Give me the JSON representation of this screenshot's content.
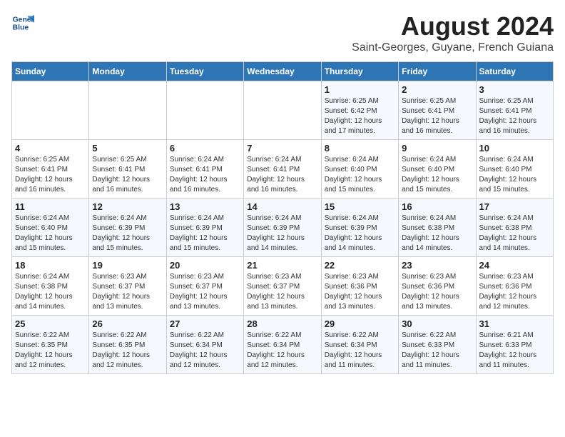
{
  "logo": {
    "line1": "General",
    "line2": "Blue"
  },
  "title": "August 2024",
  "subtitle": "Saint-Georges, Guyane, French Guiana",
  "header": {
    "colors": {
      "accent": "#2e75b6"
    }
  },
  "weekdays": [
    "Sunday",
    "Monday",
    "Tuesday",
    "Wednesday",
    "Thursday",
    "Friday",
    "Saturday"
  ],
  "weeks": [
    [
      {
        "day": "",
        "info": ""
      },
      {
        "day": "",
        "info": ""
      },
      {
        "day": "",
        "info": ""
      },
      {
        "day": "",
        "info": ""
      },
      {
        "day": "1",
        "info": "Sunrise: 6:25 AM\nSunset: 6:42 PM\nDaylight: 12 hours\nand 17 minutes."
      },
      {
        "day": "2",
        "info": "Sunrise: 6:25 AM\nSunset: 6:41 PM\nDaylight: 12 hours\nand 16 minutes."
      },
      {
        "day": "3",
        "info": "Sunrise: 6:25 AM\nSunset: 6:41 PM\nDaylight: 12 hours\nand 16 minutes."
      }
    ],
    [
      {
        "day": "4",
        "info": "Sunrise: 6:25 AM\nSunset: 6:41 PM\nDaylight: 12 hours\nand 16 minutes."
      },
      {
        "day": "5",
        "info": "Sunrise: 6:25 AM\nSunset: 6:41 PM\nDaylight: 12 hours\nand 16 minutes."
      },
      {
        "day": "6",
        "info": "Sunrise: 6:24 AM\nSunset: 6:41 PM\nDaylight: 12 hours\nand 16 minutes."
      },
      {
        "day": "7",
        "info": "Sunrise: 6:24 AM\nSunset: 6:41 PM\nDaylight: 12 hours\nand 16 minutes."
      },
      {
        "day": "8",
        "info": "Sunrise: 6:24 AM\nSunset: 6:40 PM\nDaylight: 12 hours\nand 15 minutes."
      },
      {
        "day": "9",
        "info": "Sunrise: 6:24 AM\nSunset: 6:40 PM\nDaylight: 12 hours\nand 15 minutes."
      },
      {
        "day": "10",
        "info": "Sunrise: 6:24 AM\nSunset: 6:40 PM\nDaylight: 12 hours\nand 15 minutes."
      }
    ],
    [
      {
        "day": "11",
        "info": "Sunrise: 6:24 AM\nSunset: 6:40 PM\nDaylight: 12 hours\nand 15 minutes."
      },
      {
        "day": "12",
        "info": "Sunrise: 6:24 AM\nSunset: 6:39 PM\nDaylight: 12 hours\nand 15 minutes."
      },
      {
        "day": "13",
        "info": "Sunrise: 6:24 AM\nSunset: 6:39 PM\nDaylight: 12 hours\nand 15 minutes."
      },
      {
        "day": "14",
        "info": "Sunrise: 6:24 AM\nSunset: 6:39 PM\nDaylight: 12 hours\nand 14 minutes."
      },
      {
        "day": "15",
        "info": "Sunrise: 6:24 AM\nSunset: 6:39 PM\nDaylight: 12 hours\nand 14 minutes."
      },
      {
        "day": "16",
        "info": "Sunrise: 6:24 AM\nSunset: 6:38 PM\nDaylight: 12 hours\nand 14 minutes."
      },
      {
        "day": "17",
        "info": "Sunrise: 6:24 AM\nSunset: 6:38 PM\nDaylight: 12 hours\nand 14 minutes."
      }
    ],
    [
      {
        "day": "18",
        "info": "Sunrise: 6:24 AM\nSunset: 6:38 PM\nDaylight: 12 hours\nand 14 minutes."
      },
      {
        "day": "19",
        "info": "Sunrise: 6:23 AM\nSunset: 6:37 PM\nDaylight: 12 hours\nand 13 minutes."
      },
      {
        "day": "20",
        "info": "Sunrise: 6:23 AM\nSunset: 6:37 PM\nDaylight: 12 hours\nand 13 minutes."
      },
      {
        "day": "21",
        "info": "Sunrise: 6:23 AM\nSunset: 6:37 PM\nDaylight: 12 hours\nand 13 minutes."
      },
      {
        "day": "22",
        "info": "Sunrise: 6:23 AM\nSunset: 6:36 PM\nDaylight: 12 hours\nand 13 minutes."
      },
      {
        "day": "23",
        "info": "Sunrise: 6:23 AM\nSunset: 6:36 PM\nDaylight: 12 hours\nand 13 minutes."
      },
      {
        "day": "24",
        "info": "Sunrise: 6:23 AM\nSunset: 6:36 PM\nDaylight: 12 hours\nand 12 minutes."
      }
    ],
    [
      {
        "day": "25",
        "info": "Sunrise: 6:22 AM\nSunset: 6:35 PM\nDaylight: 12 hours\nand 12 minutes."
      },
      {
        "day": "26",
        "info": "Sunrise: 6:22 AM\nSunset: 6:35 PM\nDaylight: 12 hours\nand 12 minutes."
      },
      {
        "day": "27",
        "info": "Sunrise: 6:22 AM\nSunset: 6:34 PM\nDaylight: 12 hours\nand 12 minutes."
      },
      {
        "day": "28",
        "info": "Sunrise: 6:22 AM\nSunset: 6:34 PM\nDaylight: 12 hours\nand 12 minutes."
      },
      {
        "day": "29",
        "info": "Sunrise: 6:22 AM\nSunset: 6:34 PM\nDaylight: 12 hours\nand 11 minutes."
      },
      {
        "day": "30",
        "info": "Sunrise: 6:22 AM\nSunset: 6:33 PM\nDaylight: 12 hours\nand 11 minutes."
      },
      {
        "day": "31",
        "info": "Sunrise: 6:21 AM\nSunset: 6:33 PM\nDaylight: 12 hours\nand 11 minutes."
      }
    ]
  ]
}
